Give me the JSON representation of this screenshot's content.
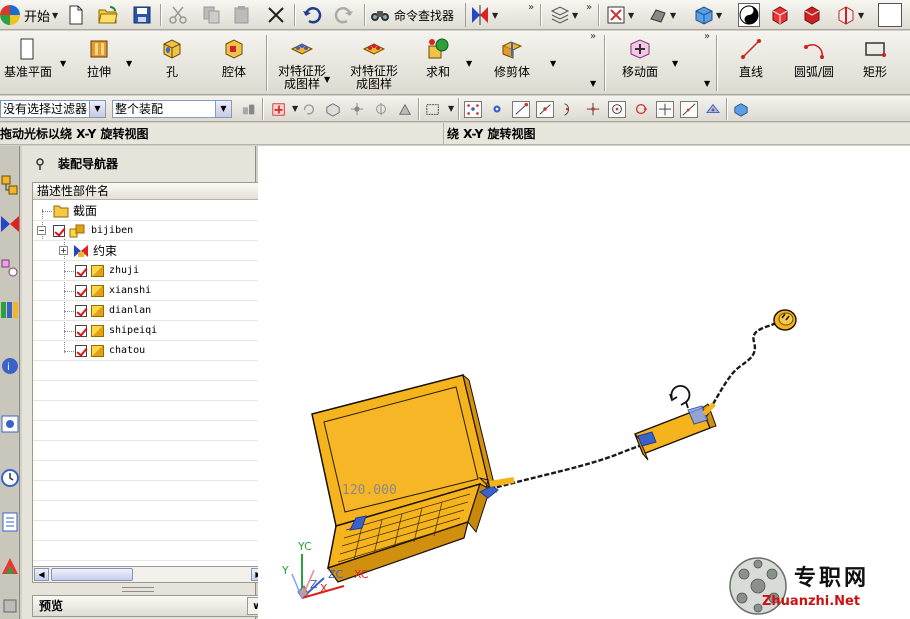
{
  "toolbar_standard": {
    "start_label": "开始",
    "command_finder_label": "命令查找器"
  },
  "toolbar_features": {
    "items": [
      {
        "label": "基准平面"
      },
      {
        "label": "拉伸"
      },
      {
        "label": "孔"
      },
      {
        "label": "腔体"
      },
      {
        "label_line1": "对特征形",
        "label_line2": "成图样"
      },
      {
        "label_line1": "对特征形",
        "label_line2": "成图样"
      },
      {
        "label": "求和"
      },
      {
        "label": "修剪体"
      },
      {
        "label": "移动面"
      },
      {
        "label": "直线"
      },
      {
        "label": "圆弧/圆"
      },
      {
        "label": "矩形"
      }
    ]
  },
  "selection_bar": {
    "filter_value": "没有选择过滤器",
    "scope_value": "整个装配"
  },
  "cue_line": {
    "cue": "拖动光标以绕 X-Y 旋转视图",
    "status": "绕 X-Y 旋转视图"
  },
  "navigator": {
    "title": "装配导航器",
    "column_header": "描述性部件名",
    "nodes": {
      "sections": "截面",
      "root": "bijiben",
      "constraints": "约束",
      "parts": [
        "zhuji",
        "xianshi",
        "dianlan",
        "shipeiqi",
        "chatou"
      ]
    },
    "preview_label": "预览"
  },
  "graphics": {
    "display_readout": "120.000",
    "triad": {
      "yc": "YC",
      "zc": "ZC",
      "xc": "XC",
      "y": "Y",
      "z": "Z",
      "x": "X"
    }
  },
  "watermark": {
    "name": "专职网",
    "url": "Zhuanzhi.Net"
  },
  "colors": {
    "part_yellow": "#f5b31e",
    "part_outline": "#1a1200",
    "accent_blue": "#3a62c8",
    "check_red": "#d11"
  }
}
